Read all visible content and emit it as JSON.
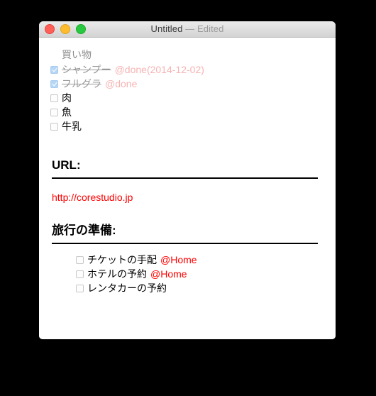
{
  "window": {
    "title_name": "Untitled",
    "title_separator": "—",
    "title_state": "Edited",
    "traffic_lights": {
      "close_label": "close",
      "minimize_label": "minimize",
      "maximize_label": "maximize",
      "close_color": "#ff5f57",
      "minimize_color": "#ffbd2e",
      "maximize_color": "#28c840"
    }
  },
  "colors": {
    "desktop_background": "#000000",
    "paper": "#ffffff",
    "done_tag": "#f7b3b3",
    "context_tag": "#ff0000",
    "url_link": "#ff0000",
    "done_text": "#9a9a9a",
    "project_title": "#8d8d8d",
    "checkbox_checked": "#b6d6f5",
    "checkbox_unchecked_border": "#c8c8c8"
  },
  "document": {
    "shopping": {
      "project_title": "買い物",
      "tasks": [
        {
          "text": "シャンプー",
          "done": true,
          "tag": "@done(2014-12-02)",
          "tag_type": "done"
        },
        {
          "text": "フルグラ",
          "done": true,
          "tag": "@done",
          "tag_type": "done"
        },
        {
          "text": "肉",
          "done": false,
          "tag": "",
          "tag_type": ""
        },
        {
          "text": "魚",
          "done": false,
          "tag": "",
          "tag_type": ""
        },
        {
          "text": "牛乳",
          "done": false,
          "tag": "",
          "tag_type": ""
        }
      ]
    },
    "url_section": {
      "heading": "URL:",
      "link_text": "http://corestudio.jp"
    },
    "travel_section": {
      "heading": "旅行の準備:",
      "tasks": [
        {
          "text": "チケットの手配",
          "done": false,
          "tag": "@Home",
          "tag_type": "ctx"
        },
        {
          "text": "ホテルの予約",
          "done": false,
          "tag": "@Home",
          "tag_type": "ctx"
        },
        {
          "text": "レンタカーの予約",
          "done": false,
          "tag": "",
          "tag_type": ""
        }
      ]
    }
  }
}
